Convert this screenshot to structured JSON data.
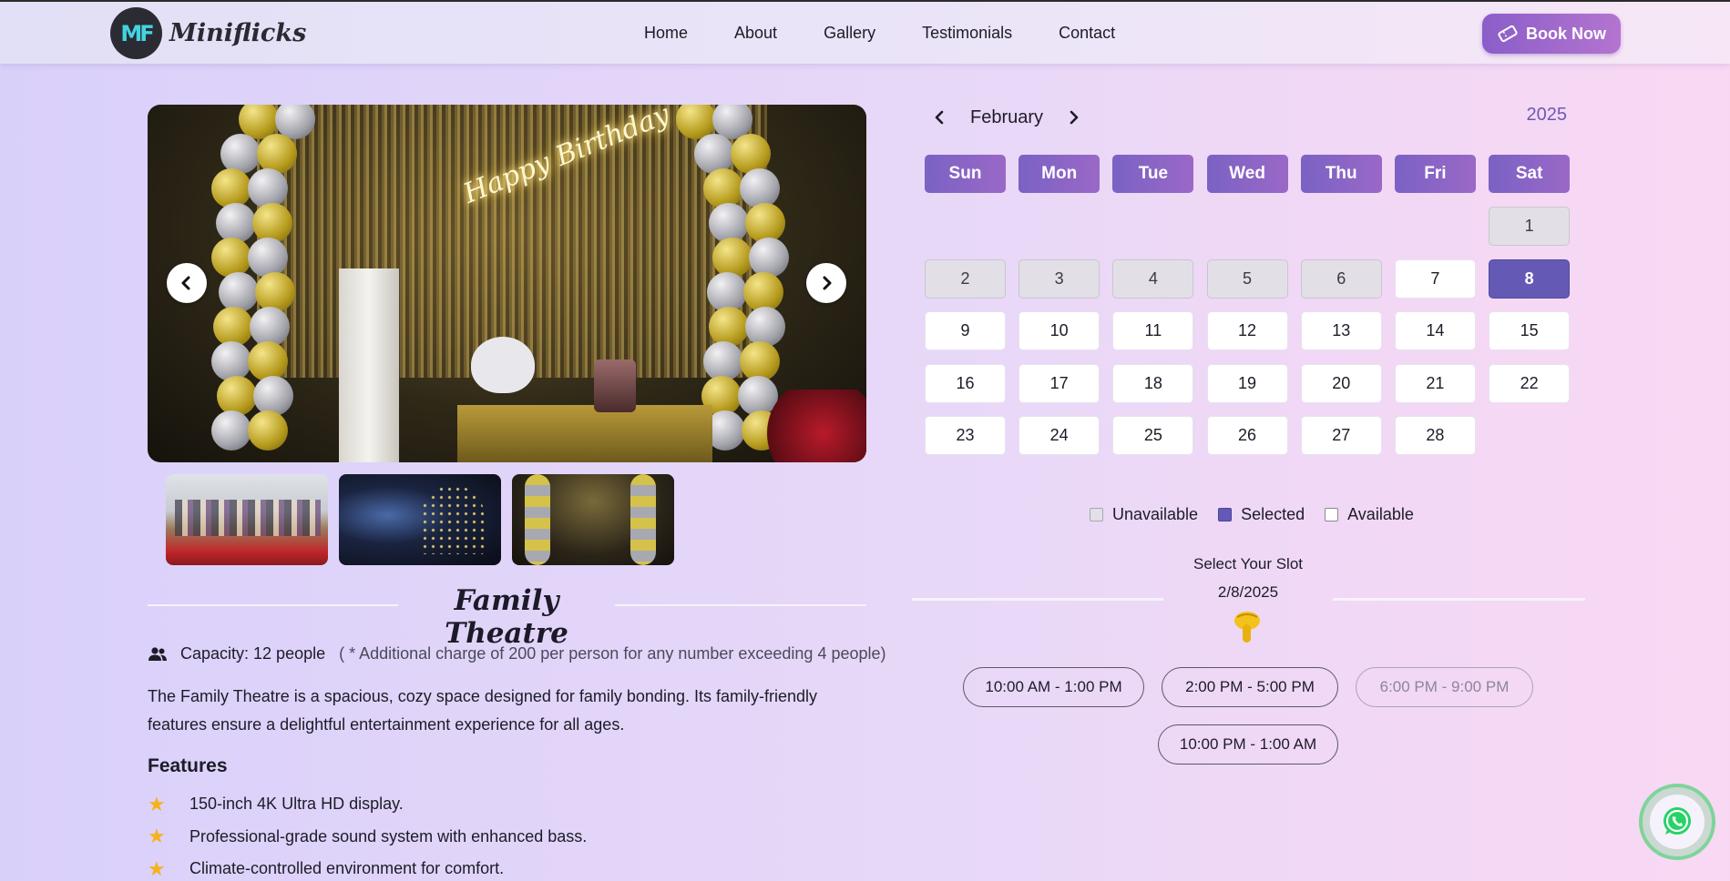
{
  "nav": {
    "logo_text": "Miniflicks",
    "logo_mark": "MF",
    "links": [
      "Home",
      "About",
      "Gallery",
      "Testimonials",
      "Contact"
    ],
    "book_label": "Book Now"
  },
  "room": {
    "title": "Family Theatre",
    "capacity": "Capacity: 12 people",
    "capacity_note": "( * Additional charge of 200 per person for any number exceeding 4 people)",
    "description": "The Family Theatre is a spacious, cozy space designed for family bonding. Its family-friendly features ensure a delightful entertainment experience for all ages.",
    "features_heading": "Features",
    "features": [
      "150-inch 4K Ultra HD display.",
      "Professional-grade sound system with enhanced bass.",
      "Climate-controlled environment for comfort."
    ],
    "hero_neon_text": "Happy Birthday"
  },
  "calendar": {
    "month": "February",
    "year": "2025",
    "weekdays": [
      "Sun",
      "Mon",
      "Tue",
      "Wed",
      "Thu",
      "Fri",
      "Sat"
    ],
    "leading_blanks": 6,
    "days": [
      {
        "d": "1",
        "s": "unavailable"
      },
      {
        "d": "2",
        "s": "unavailable"
      },
      {
        "d": "3",
        "s": "unavailable"
      },
      {
        "d": "4",
        "s": "unavailable"
      },
      {
        "d": "5",
        "s": "unavailable"
      },
      {
        "d": "6",
        "s": "unavailable"
      },
      {
        "d": "7",
        "s": "available"
      },
      {
        "d": "8",
        "s": "selected"
      },
      {
        "d": "9",
        "s": "available"
      },
      {
        "d": "10",
        "s": "available"
      },
      {
        "d": "11",
        "s": "available"
      },
      {
        "d": "12",
        "s": "available"
      },
      {
        "d": "13",
        "s": "available"
      },
      {
        "d": "14",
        "s": "available"
      },
      {
        "d": "15",
        "s": "available"
      },
      {
        "d": "16",
        "s": "available"
      },
      {
        "d": "17",
        "s": "available"
      },
      {
        "d": "18",
        "s": "available"
      },
      {
        "d": "19",
        "s": "available"
      },
      {
        "d": "20",
        "s": "available"
      },
      {
        "d": "21",
        "s": "available"
      },
      {
        "d": "22",
        "s": "available"
      },
      {
        "d": "23",
        "s": "available"
      },
      {
        "d": "24",
        "s": "available"
      },
      {
        "d": "25",
        "s": "available"
      },
      {
        "d": "26",
        "s": "available"
      },
      {
        "d": "27",
        "s": "available"
      },
      {
        "d": "28",
        "s": "available"
      }
    ],
    "legend": {
      "unavailable": "Unavailable",
      "selected": "Selected",
      "available": "Available"
    }
  },
  "slots": {
    "title": "Select Your Slot",
    "date": "2/8/2025",
    "items": [
      {
        "label": "10:00 AM - 1:00 PM",
        "disabled": false
      },
      {
        "label": "2:00 PM - 5:00 PM",
        "disabled": false
      },
      {
        "label": "6:00 PM - 9:00 PM",
        "disabled": true
      },
      {
        "label": "10:00 PM - 1:00 AM",
        "disabled": false
      }
    ]
  },
  "colors": {
    "accent": "#645ab6",
    "book_button": "#9a68c7",
    "whatsapp": "#25d366"
  },
  "icons": [
    "chevron-left-icon",
    "chevron-right-icon",
    "users-icon",
    "star-icon",
    "ticket-icon",
    "pointing-down-hand-icon",
    "whatsapp-icon"
  ]
}
